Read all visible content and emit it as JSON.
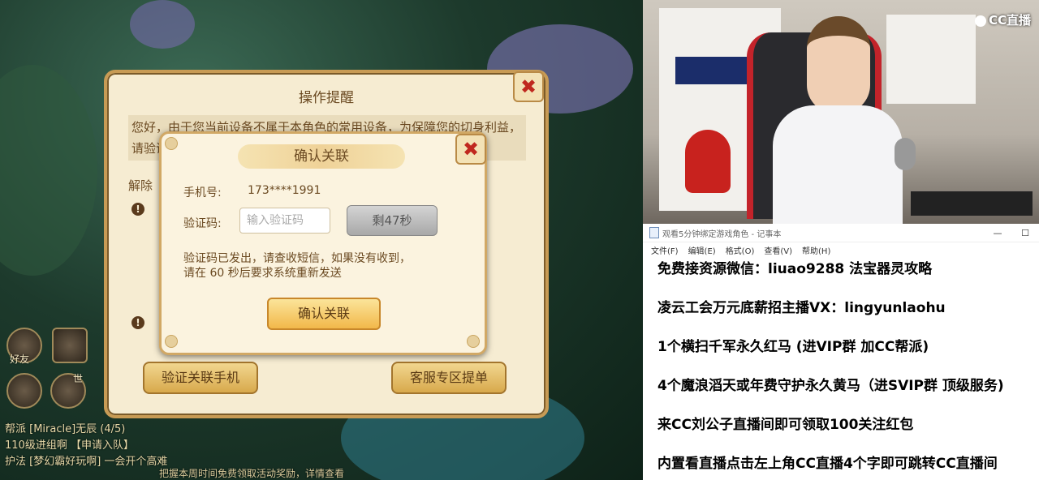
{
  "game": {
    "chat": [
      "帮派 [Miracle]无辰 (4/5)",
      "110级进组啊 【申请入队】",
      "护法 [梦幻霸好玩啊] 一会开个高难"
    ],
    "side_labels": {
      "friends": "好友",
      "world": "世"
    },
    "bottom_hint": "把握本周时间免费领取活动奖励，详情查看"
  },
  "outer_dialog": {
    "title": "操作提醒",
    "body": "您好，由于您当前设备不属于本角色的常用设备，为保障您的切身利益，请验证关联手机后再进行操作，否则将受到限制。",
    "unbind_label": "解除",
    "verify_phone_button": "验证关联手机",
    "customer_service_button": "客服专区提单",
    "close_symbol": "✖"
  },
  "inner_dialog": {
    "title": "确认关联",
    "phone_label": "手机号:",
    "phone_value": "173****1991",
    "code_label": "验证码:",
    "code_placeholder": "输入验证码",
    "countdown_button": "剩47秒",
    "message_line1": "验证码已发出，请查收短信，如果没有收到，",
    "message_line2": "请在 60 秒后要求系统重新发送",
    "confirm_button": "确认关联",
    "close_symbol": "✖"
  },
  "stream": {
    "logo_text": "CC直播"
  },
  "notepad": {
    "title": "观看5分钟绑定游戏角色 - 记事本",
    "menu": [
      "文件(F)",
      "编辑(E)",
      "格式(O)",
      "查看(V)",
      "帮助(H)"
    ],
    "window_controls": [
      "—",
      "☐"
    ],
    "lines": [
      "免费接资源微信：liuao9288 法宝器灵攻略",
      "凌云工会万元底薪招主播VX：lingyunlaohu",
      "1个横扫千军永久红马 (进VIP群 加CC帮派)",
      "4个魔浪滔天或年费守护永久黄马（进SVIP群 顶级服务)",
      "来CC刘公子直播间即可领取100关注红包",
      "内置看直播点击左上角CC直播4个字即可跳转CC直播间"
    ]
  }
}
